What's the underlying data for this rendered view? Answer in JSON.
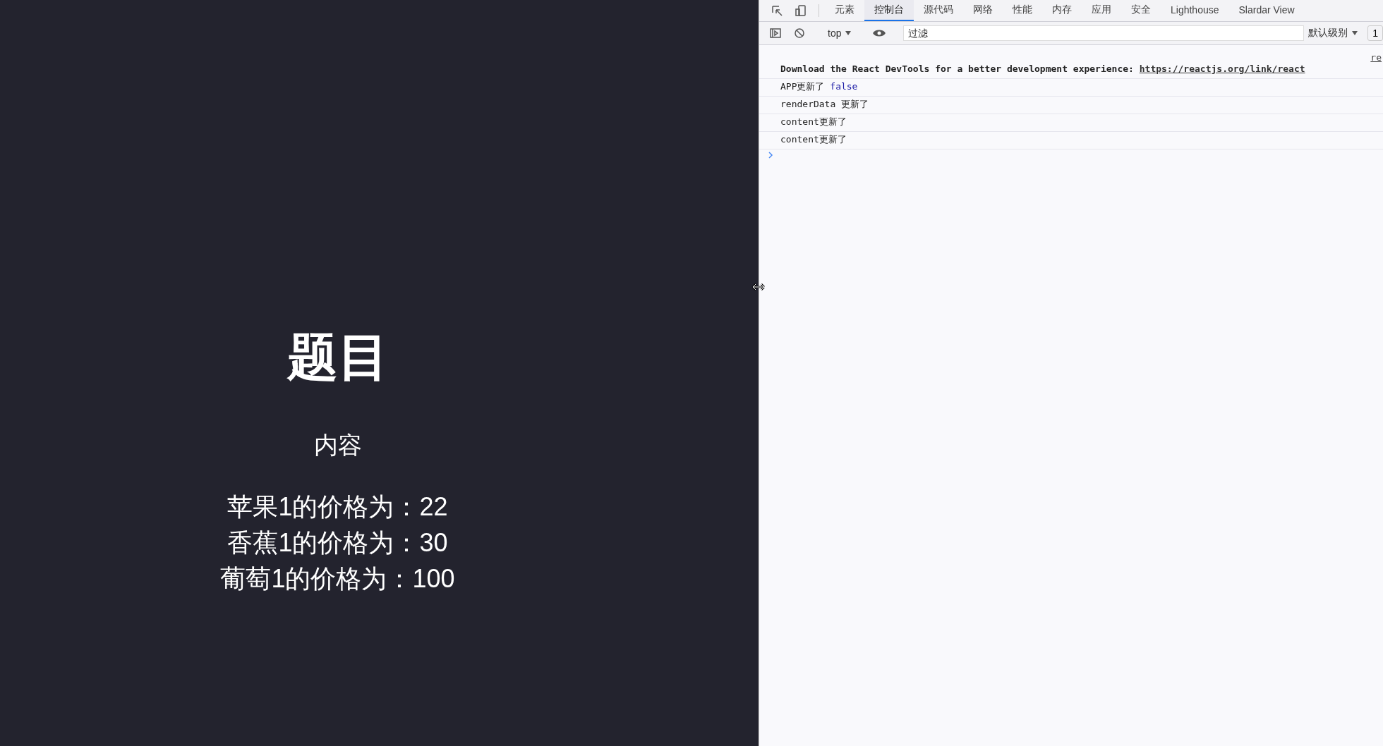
{
  "page": {
    "title": "题目",
    "subtitle": "内容",
    "prices": [
      "苹果1的价格为：22",
      "香蕉1的价格为：30",
      "葡萄1的价格为：100"
    ]
  },
  "devtools": {
    "tabs": [
      {
        "label": "元素",
        "selected": false
      },
      {
        "label": "控制台",
        "selected": true
      },
      {
        "label": "源代码",
        "selected": false
      },
      {
        "label": "网络",
        "selected": false
      },
      {
        "label": "性能",
        "selected": false
      },
      {
        "label": "内存",
        "selected": false
      },
      {
        "label": "应用",
        "selected": false
      },
      {
        "label": "安全",
        "selected": false
      },
      {
        "label": "Lighthouse",
        "selected": false
      },
      {
        "label": "Slardar View",
        "selected": false
      }
    ],
    "toolbar": {
      "context": "top",
      "filter": {
        "placeholder": "过滤"
      },
      "levels": "默认级别",
      "issues": "1"
    },
    "messages": [
      {
        "source": "re",
        "text": "Download the React DevTools for a better development experience: ",
        "link": "https://reactjs.org/link/react",
        "bold": true
      },
      {
        "text": "APP更新了 ",
        "value": "false",
        "bold": false
      },
      {
        "text": "renderData 更新了",
        "bold": false
      },
      {
        "text": "content更新了",
        "bold": false
      },
      {
        "text": "content更新了",
        "bold": false
      }
    ]
  }
}
